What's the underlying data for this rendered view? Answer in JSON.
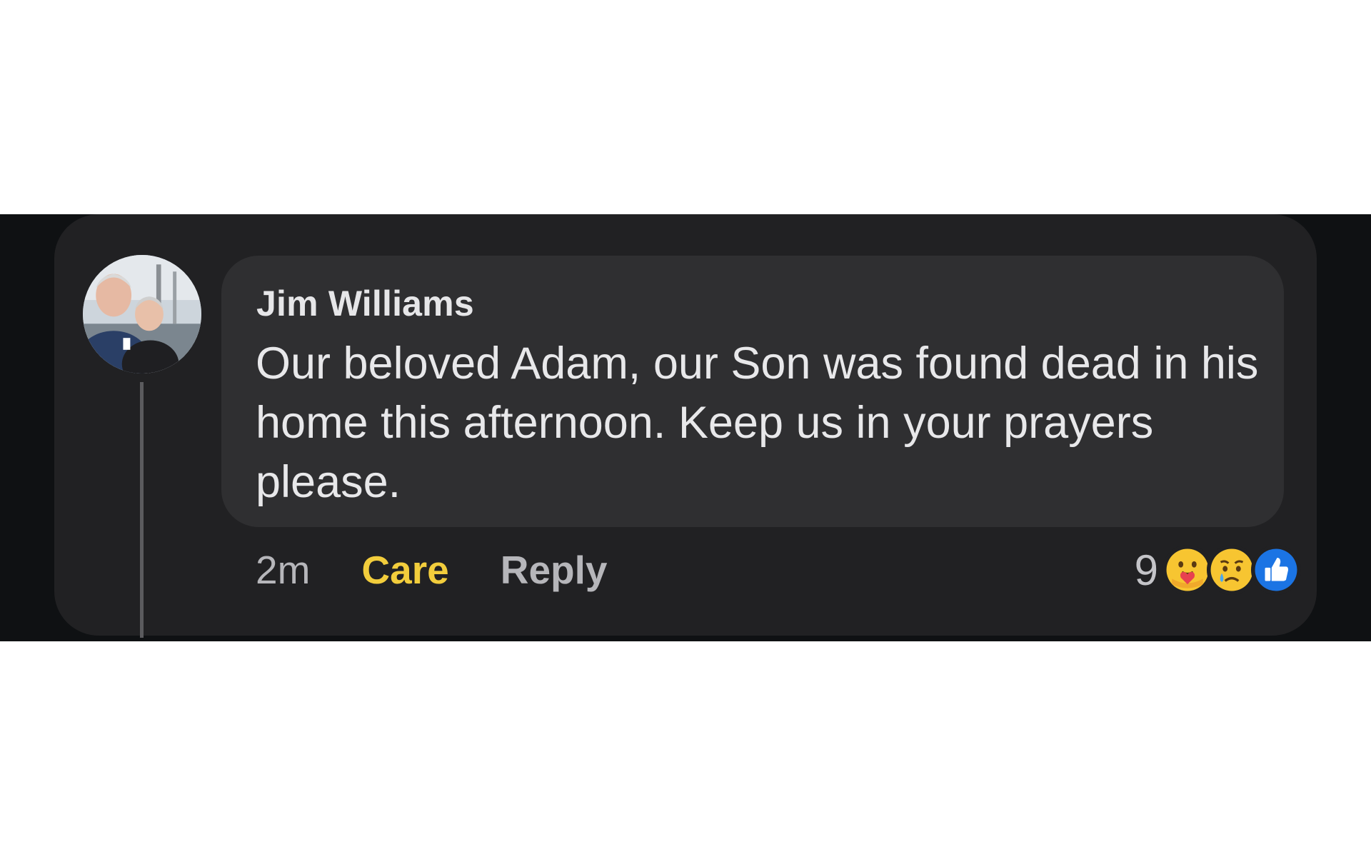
{
  "comment": {
    "author": "Jim Williams",
    "text": "Our beloved Adam, our Son was found dead in his home this afternoon. Keep us in your prayers please.",
    "timestamp": "2m",
    "actions": {
      "care_label": "Care",
      "reply_label": "Reply"
    },
    "reactions": {
      "count": "9",
      "icons": [
        "care-icon",
        "sad-icon",
        "like-icon"
      ]
    }
  },
  "colors": {
    "background_band": "#0f1113",
    "card": "#212123",
    "bubble": "#2f2f31",
    "care_accent": "#f2cd3c",
    "like_blue": "#1b74e4"
  }
}
